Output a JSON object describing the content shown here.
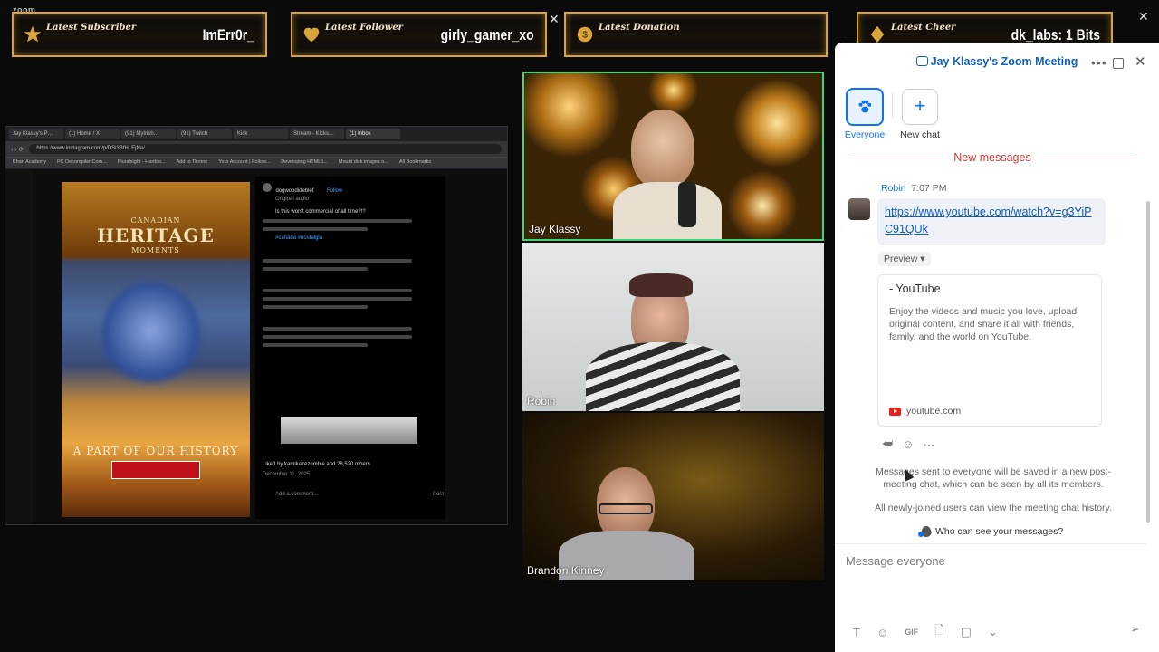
{
  "app": {
    "logo": "zoom",
    "close_glyph": "✕"
  },
  "banners": [
    {
      "tag": "Latest Subscriber",
      "value": "ImErr0r_"
    },
    {
      "tag": "Latest Follower",
      "value": "girly_gamer_xo"
    },
    {
      "tag": "Latest Donation",
      "value": ""
    },
    {
      "tag": "Latest Cheer",
      "value": "dk_labs: 1 Bits"
    }
  ],
  "share": {
    "tabs": [
      "Jay Klassy's P…",
      "(1) Home / X",
      "(91) MyIrish…",
      "(91) Twitch",
      "Kick",
      "Stream - Kicks…",
      "(1) Inbox"
    ],
    "url": "https://www.instagram.com/p/DSi3BfHLEjNa/",
    "bookmarks": [
      "Khan Academy",
      "PC Decompiler Com...",
      "Pluralsight - Hardco...",
      "Add to Throne",
      "Your Account | Follow...",
      "Developing HTML5...",
      "Mount disk images o...",
      "All Bookmarks"
    ],
    "video": {
      "heritage_top": "CANADIAN",
      "heritage_main": "HERITAGE",
      "heritage_sub": "MOMENTS",
      "bottom_caption": "A PART OF OUR HISTORY"
    },
    "post": {
      "author": "dogwoodideblef",
      "follow": "Follow",
      "audio": "Original audio",
      "caption": "Is this worst commercial of all time?!?",
      "hashtags": "#canada #nostalgia",
      "likes": "Liked by kamikazezombie and 28,520 others",
      "date": "December 11, 2025",
      "add_comment": "Add a comment...",
      "post_btn": "Post"
    }
  },
  "participants": [
    {
      "name": "Jay Klassy"
    },
    {
      "name": "Robin"
    },
    {
      "name": "Brandon Kinney"
    }
  ],
  "chat": {
    "title": "Jay Klassy's Zoom Meeting",
    "more_glyph": "•••",
    "close_glyph": "✕",
    "everyone_label": "Everyone",
    "new_chat_label": "New chat",
    "new_chat_glyph": "+",
    "new_messages": "New messages",
    "message": {
      "sender": "Robin",
      "time": "7:07 PM",
      "link": "https://www.youtube.com/watch?v=g3YiPC91QUk"
    },
    "preview_label": "Preview ▾",
    "card": {
      "title": "- YouTube",
      "description": "Enjoy the videos and music you love, upload original content, and share it all with friends, family, and the world on YouTube.",
      "site": "youtube.com"
    },
    "notice": "Messages sent to everyone will be saved in a new post-meeting chat, which can be seen by all its members.",
    "notice2": "All newly-joined users can view the meeting chat history.",
    "who_can_see": "Who can see your messages?",
    "placeholder": "Message everyone",
    "toolbar": {
      "format": "T",
      "emoji": "☺",
      "gif": "GIF",
      "file": "🗋",
      "screenshot": "▢",
      "more": "⌄",
      "send": "➢"
    }
  },
  "colors": {
    "accent": "#0e72ed",
    "active_speaker": "#3ed37c",
    "banner_gold": "#d9a53a",
    "new_messages_red": "#d93a3a"
  }
}
